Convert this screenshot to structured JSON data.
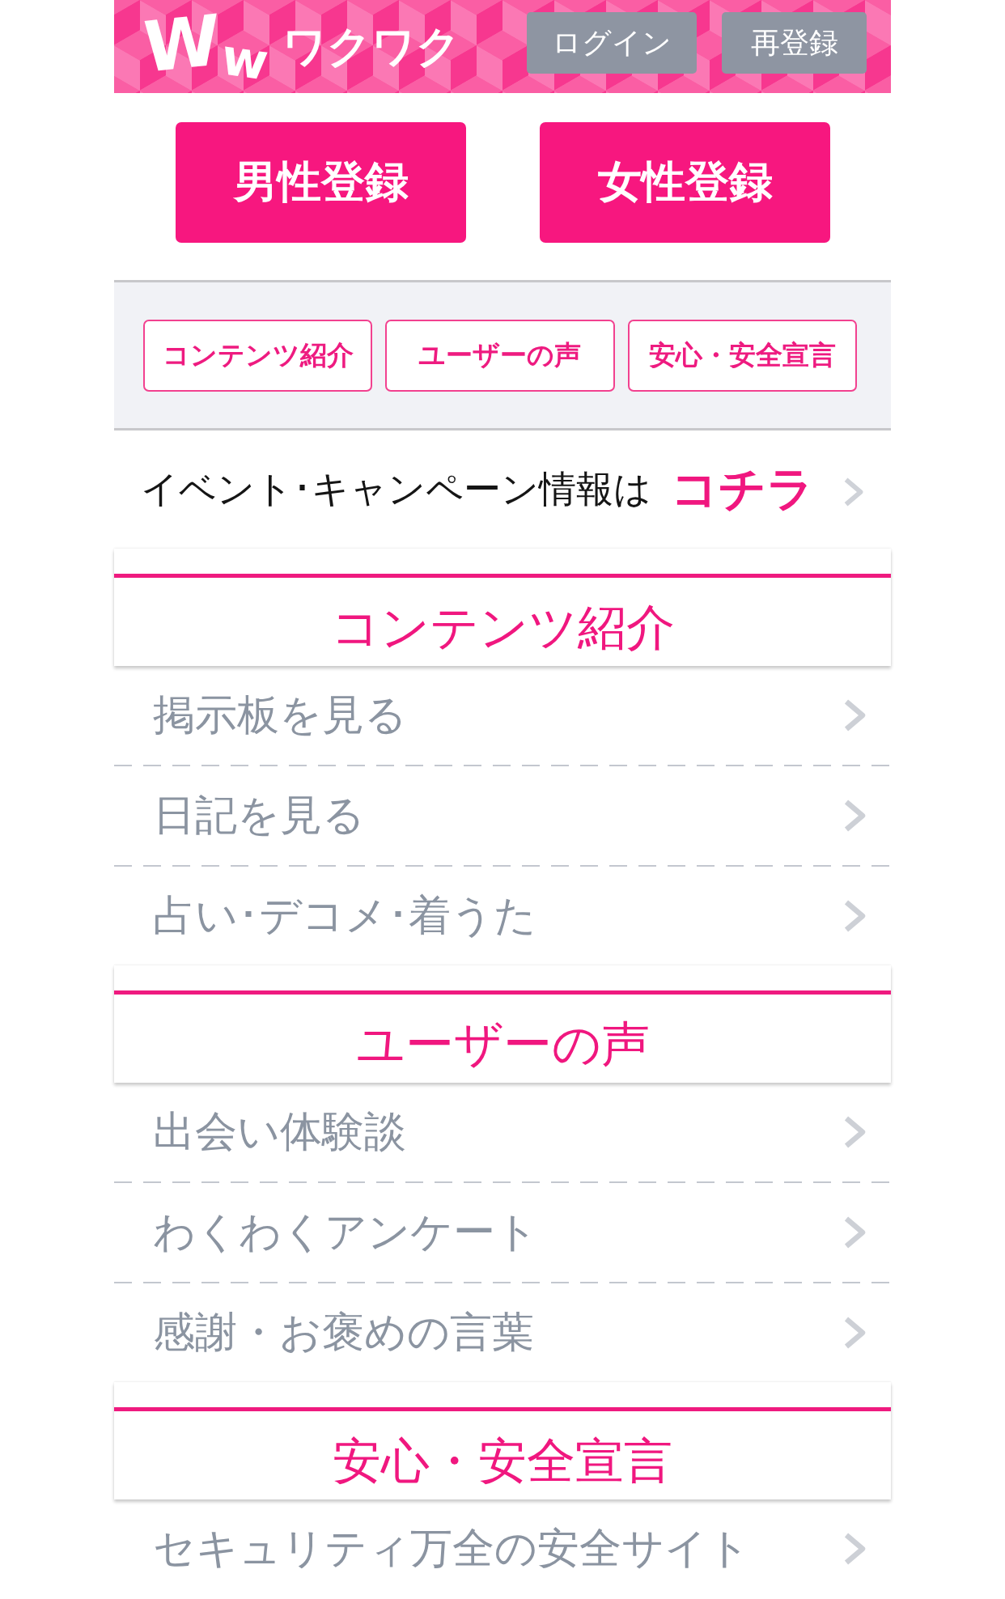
{
  "header": {
    "logo": {
      "mark": "Ww",
      "name": "ワクワク"
    },
    "buttons": [
      "ログイン",
      "再登録"
    ]
  },
  "register_buttons": [
    "男性登録",
    "女性登録"
  ],
  "tabs": [
    "コンテンツ紹介",
    "ユーザーの声",
    "安心・安全宣言"
  ],
  "event_banner": {
    "text": "イベント･キャンペーン情報は",
    "link": "コチラ"
  },
  "sections": [
    {
      "title": "コンテンツ紹介",
      "items": [
        "掲示板を見る",
        "日記を見る",
        "占い･デコメ･着うた"
      ]
    },
    {
      "title": "ユーザーの声",
      "items": [
        "出会い体験談",
        "わくわくアンケート",
        "感謝・お褒めの言葉"
      ]
    },
    {
      "title": "安心・安全宣言",
      "items": [
        "セキュリティ万全の安全サイト"
      ]
    }
  ]
}
